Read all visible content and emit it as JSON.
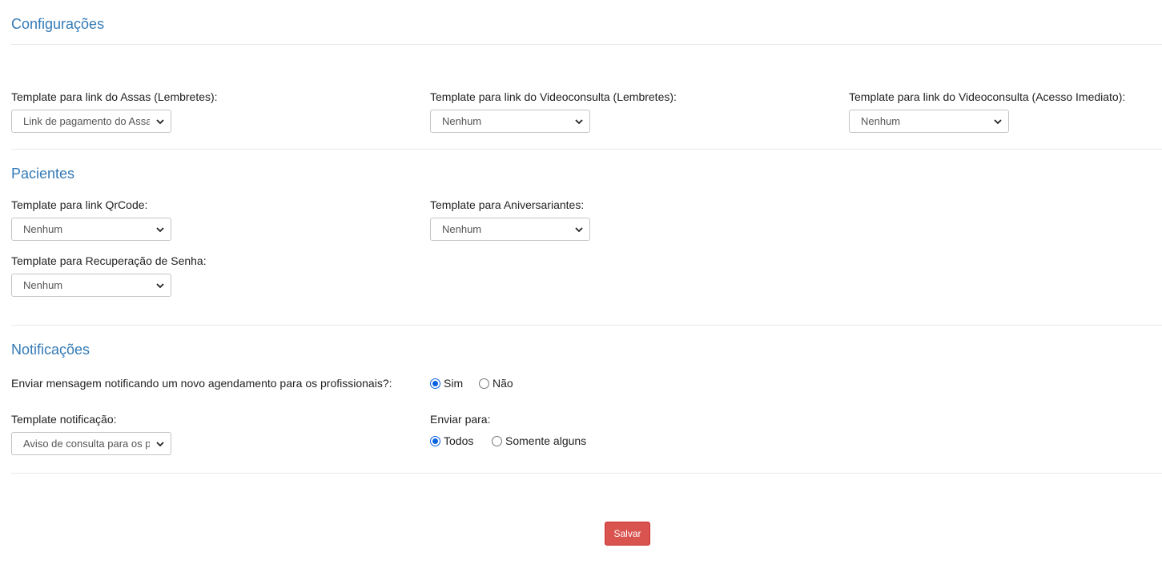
{
  "sections": {
    "configuracoes": {
      "title": "Configurações",
      "assas": {
        "label": "Template para link do Assas (Lembretes):",
        "value": "Link de pagamento do Assas"
      },
      "video_lembretes": {
        "label": "Template para link do Videoconsulta (Lembretes):",
        "value": "Nenhum"
      },
      "video_imediato": {
        "label": "Template para link do Videoconsulta (Acesso Imediato):",
        "value": "Nenhum"
      }
    },
    "pacientes": {
      "title": "Pacientes",
      "qrcode": {
        "label": "Template para link QrCode:",
        "value": "Nenhum"
      },
      "aniversariantes": {
        "label": "Template para Aniversariantes:",
        "value": "Nenhum"
      },
      "recuperacao": {
        "label": "Template para Recuperação de Senha:",
        "value": "Nenhum"
      }
    },
    "notificacoes": {
      "title": "Notificações",
      "question": "Enviar mensagem notificando um novo agendamento para os profissionais?:",
      "options": {
        "sim": "Sim",
        "nao": "Não",
        "selected": "sim"
      },
      "template": {
        "label": "Template notificação:",
        "value": "Aviso de consulta para os profissionais"
      },
      "enviar_para": {
        "label": "Enviar para:",
        "todos": "Todos",
        "alguns": "Somente alguns",
        "selected": "todos"
      }
    }
  },
  "actions": {
    "save_label": "Salvar"
  },
  "colors": {
    "section_title": "#337ab7",
    "save_button": "#d9534f",
    "radio_selected": "#0b62e0"
  },
  "icons": {
    "select_arrow": "chevron-down-icon"
  }
}
